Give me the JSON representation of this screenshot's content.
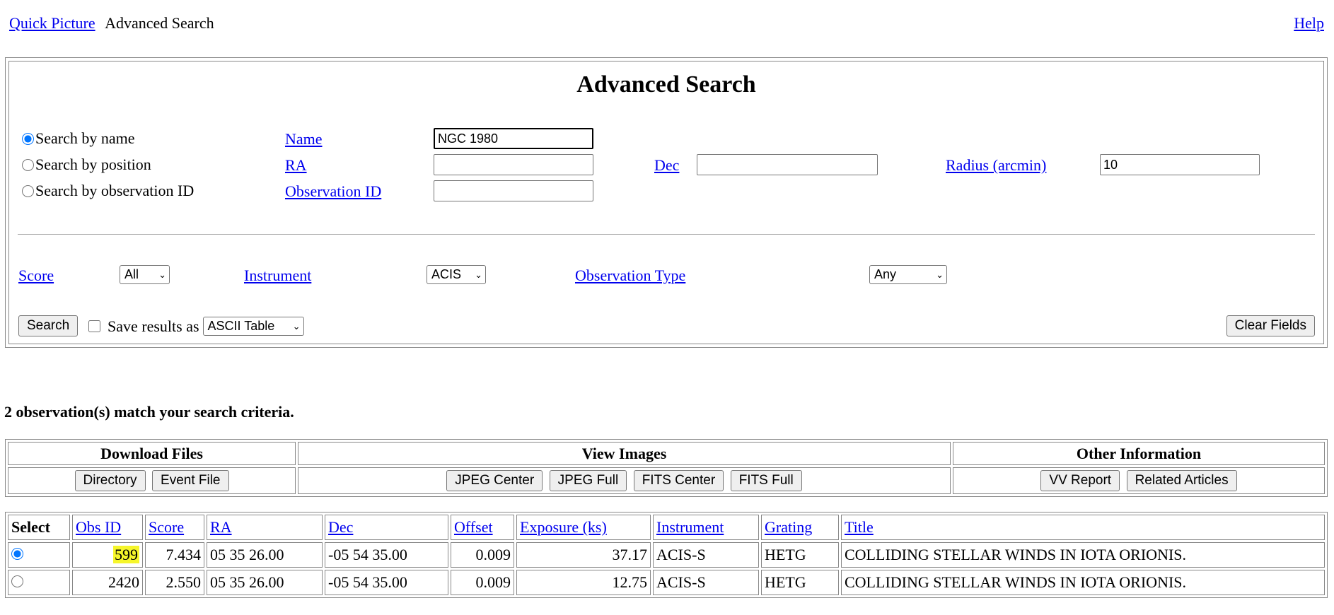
{
  "nav": {
    "quick_picture": "Quick Picture",
    "advanced_search": "Advanced Search",
    "help": "Help"
  },
  "form": {
    "title": "Advanced Search",
    "modes": [
      {
        "label": "Search by name",
        "checked": true
      },
      {
        "label": "Search by position",
        "checked": false
      },
      {
        "label": "Search by observation ID",
        "checked": false
      }
    ],
    "name_label": "Name",
    "name_value": "NGC 1980",
    "ra_label": "RA",
    "ra_value": "",
    "dec_label": "Dec",
    "dec_value": "",
    "radius_label": "Radius (arcmin)",
    "radius_value": "10",
    "obsid_label": "Observation ID",
    "obsid_value": "",
    "score_label": "Score",
    "score_value": "All",
    "instrument_label": "Instrument",
    "instrument_value": "ACIS",
    "obstype_label": "Observation Type",
    "obstype_value": "Any",
    "search_button": "Search",
    "save_label": "Save results as",
    "save_checked": false,
    "save_format": "ASCII Table",
    "clear_button": "Clear Fields"
  },
  "results": {
    "count_text": "2 observation(s) match your search criteria.",
    "actions": {
      "download_header": "Download Files",
      "view_header": "View Images",
      "other_header": "Other Information",
      "directory": "Directory",
      "event_file": "Event File",
      "jpeg_center": "JPEG Center",
      "jpeg_full": "JPEG Full",
      "fits_center": "FITS Center",
      "fits_full": "FITS Full",
      "vv_report": "VV Report",
      "related_articles": "Related Articles"
    },
    "columns": [
      "Select",
      "Obs ID",
      "Score",
      "RA",
      "Dec",
      "Offset",
      "Exposure (ks)",
      "Instrument",
      "Grating",
      "Title"
    ],
    "highlight_color": "#f6f62a",
    "rows": [
      {
        "selected": true,
        "obs_id": "599",
        "score": "7.434",
        "ra": "05 35 26.00",
        "dec": "-05 54 35.00",
        "offset": "0.009",
        "exposure": "37.17",
        "instrument": "ACIS-S",
        "grating": "HETG",
        "title": "COLLIDING STELLAR WINDS IN IOTA ORIONIS."
      },
      {
        "selected": false,
        "obs_id": "2420",
        "score": "2.550",
        "ra": "05 35 26.00",
        "dec": "-05 54 35.00",
        "offset": "0.009",
        "exposure": "12.75",
        "instrument": "ACIS-S",
        "grating": "HETG",
        "title": "COLLIDING STELLAR WINDS IN IOTA ORIONIS."
      }
    ]
  }
}
